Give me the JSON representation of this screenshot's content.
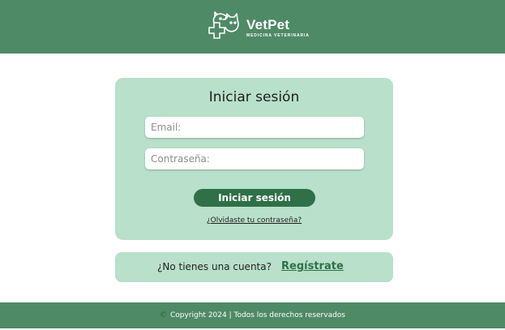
{
  "brand": {
    "name": "VetPet",
    "tagline": "MEDICINA VETERINARIA",
    "logo_icon": "vet-pet-logo-icon"
  },
  "login": {
    "title": "Iniciar sesión",
    "email_placeholder": "Email:",
    "password_placeholder": "Contraseña:",
    "submit_label": "Iniciar sesión",
    "forgot_label": "¿Olvidaste tu contraseña?"
  },
  "register": {
    "prompt": "¿No tienes una cuenta?",
    "link_label": "Regístrate"
  },
  "footer": {
    "symbol": "©",
    "text": "Copyright 2024 | Todos los derechos reservados"
  },
  "colors": {
    "header_bg": "#4e8a66",
    "card_bg": "#b8e0ca",
    "button_bg": "#2f7048",
    "link_color": "#2f7048"
  }
}
